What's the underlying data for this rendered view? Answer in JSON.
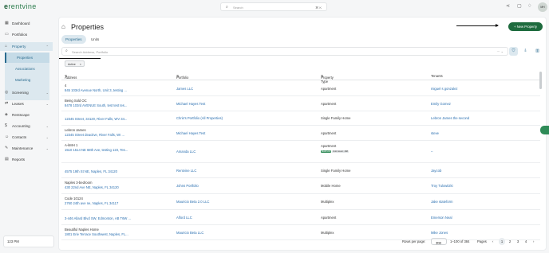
{
  "app": {
    "logo_prefix": "e",
    "logo_name": "rentvine"
  },
  "search": {
    "icon": "search-icon",
    "placeholder": "Search",
    "shortcut": "⌘ K"
  },
  "topbar": {
    "icons": [
      "share-icon",
      "clipboard-icon",
      "bell-icon"
    ],
    "avatar_initials": "MH"
  },
  "sidebar": {
    "items": [
      {
        "label": "Dashboard",
        "icon": "dashboard-icon"
      },
      {
        "label": "Portfolios",
        "icon": "briefcase-icon"
      },
      {
        "label": "Property",
        "icon": "building-icon",
        "expanded": true
      },
      {
        "label": "Screening",
        "icon": "screening-icon"
      },
      {
        "label": "Leases",
        "icon": "lease-icon"
      },
      {
        "label": "Rentscape",
        "icon": "rentscape-icon"
      },
      {
        "label": "Accounting",
        "icon": "dollar-icon"
      },
      {
        "label": "Contacts",
        "icon": "contacts-icon"
      },
      {
        "label": "Maintenance",
        "icon": "wrench-icon"
      },
      {
        "label": "Reports",
        "icon": "reports-icon"
      }
    ],
    "subitems": [
      "Properties",
      "Associations",
      "Marketing"
    ],
    "company": "123 PM"
  },
  "main": {
    "title": "Properties",
    "new_button": "+ New Property",
    "tabs": [
      "Properties",
      "Units"
    ],
    "filter_placeholder": "Search Address, Portfolio",
    "active_chip": "Active",
    "columns": [
      "Address",
      "Portfolio",
      "Property Type",
      "Tenants"
    ],
    "rows": [
      {
        "name": "4",
        "address": "845 103rd Avenue North, Unit 3, testing ...",
        "portfolio": "James LLC",
        "type": "Apartment",
        "tenant": "miguel s gonzalez",
        "badges": []
      },
      {
        "name": "Being Sold OC",
        "address": "8478 103rd AVENUE South, test test tes...",
        "portfolio": "Michael Hayes Test",
        "type": "Apartment",
        "tenant": "Emily Gomez",
        "badges": []
      },
      {
        "name": "",
        "address": "12345 Street, 34120, River Falls, WV 34...",
        "portfolio": "Chris's Portfolio (All Properties)",
        "type": "Single Family Home",
        "tenant": "Lebron James the second",
        "badges": []
      },
      {
        "name": "Lebron James",
        "address": "12345 Street deactive, River Falls, WI ...",
        "portfolio": "Michael Hayes Test",
        "type": "Apartment",
        "tenant": "steve",
        "badges": []
      },
      {
        "name": "A-kMH 1",
        "address": "1510 1514 NE 68th Ave, testing 123, Tes...",
        "portfolio": "Amanda LLC",
        "type": "Apartment",
        "tenant": "–",
        "badges": [
          "Multi Unit",
          "Unit Count: 168"
        ]
      },
      {
        "name": "",
        "address": "4575 19th St NE, Naples, FL 34120",
        "portfolio": "Rentvine LLC",
        "type": "Single Family Home",
        "tenant": "Jaycob",
        "badges": []
      },
      {
        "name": "Naples 3-bedroom",
        "address": "430 22nd Ave NE, Naples, FL 34120",
        "portfolio": "Johns Portfolio",
        "type": "Mobile Home",
        "tenant": "Troy Tulowitzki",
        "badges": []
      },
      {
        "name": "Code 10124",
        "address": "2760 24th ave ne, Naples, FL 34117",
        "portfolio": "Mauricio Beta 2.0 LLC",
        "type": "Multiplex",
        "tenant": "Jake stateform",
        "badges": []
      },
      {
        "name": "",
        "address": "3-446 Allard Blvd SW, Edmonton, AB T6W ...",
        "portfolio": "Alford LLC",
        "type": "Apartment",
        "tenant": "Emerson Neal",
        "badges": []
      },
      {
        "name": "Beautiful Naples Home",
        "address": "1801 Erie Terrace Southwest, Naples, FL...",
        "portfolio": "Mauricio Beta LLC",
        "type": "Multiplex",
        "tenant": "Mike Jones",
        "badges": []
      }
    ],
    "footer": {
      "rows_per_page_label": "Rows per page:",
      "rows_per_page": "100",
      "range": "1–100 of 384",
      "pages_label": "Pages",
      "pages": [
        "1",
        "2",
        "3",
        "4"
      ]
    }
  }
}
